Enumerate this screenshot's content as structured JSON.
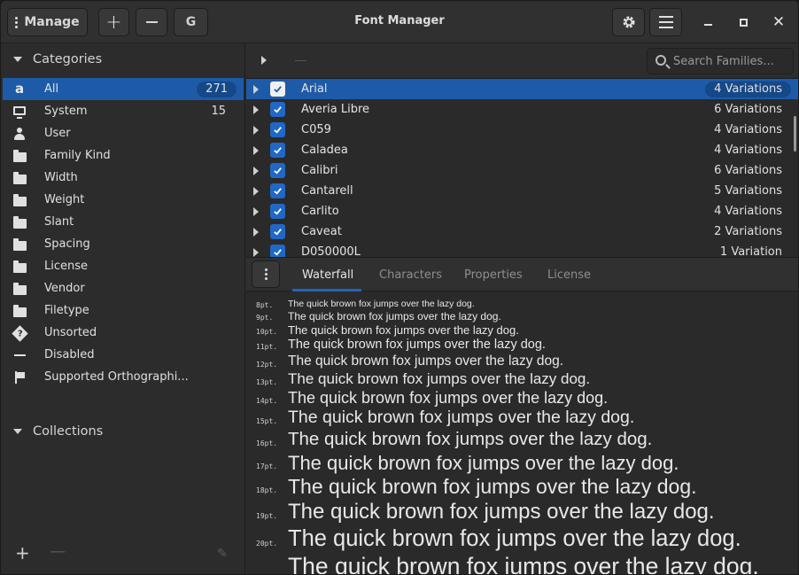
{
  "window": {
    "title": "Font Manager"
  },
  "header": {
    "manage_label": "Manage",
    "add_label": "+",
    "remove_label": "—",
    "g_label": "G",
    "min_label": "–",
    "max_label": "▫",
    "close_label": "✕"
  },
  "sidebar": {
    "categories_title": "Categories",
    "collections_title": "Collections",
    "items": [
      {
        "label": "All",
        "count": "271",
        "icon": "font-a-icon"
      },
      {
        "label": "System",
        "count": "15",
        "icon": "monitor-icon"
      },
      {
        "label": "User",
        "count": "",
        "icon": "person-icon"
      },
      {
        "label": "Family Kind",
        "count": "",
        "icon": "folder-icon"
      },
      {
        "label": "Width",
        "count": "",
        "icon": "folder-icon"
      },
      {
        "label": "Weight",
        "count": "",
        "icon": "folder-icon"
      },
      {
        "label": "Slant",
        "count": "",
        "icon": "folder-icon"
      },
      {
        "label": "Spacing",
        "count": "",
        "icon": "folder-icon"
      },
      {
        "label": "License",
        "count": "",
        "icon": "folder-icon"
      },
      {
        "label": "Vendor",
        "count": "",
        "icon": "folder-icon"
      },
      {
        "label": "Filetype",
        "count": "",
        "icon": "folder-icon"
      },
      {
        "label": "Unsorted",
        "count": "",
        "icon": "question-diamond-icon"
      },
      {
        "label": "Disabled",
        "count": "",
        "icon": "dash-icon"
      },
      {
        "label": "Supported Orthographi...",
        "count": "",
        "icon": "flag-icon"
      }
    ]
  },
  "search": {
    "placeholder": "Search Families..."
  },
  "fonts": [
    {
      "name": "Arial",
      "variations": "4 Variations"
    },
    {
      "name": "Averia Libre",
      "variations": "6 Variations"
    },
    {
      "name": "C059",
      "variations": "4 Variations"
    },
    {
      "name": "Caladea",
      "variations": "4 Variations"
    },
    {
      "name": "Calibri",
      "variations": "6 Variations"
    },
    {
      "name": "Cantarell",
      "variations": "5 Variations"
    },
    {
      "name": "Carlito",
      "variations": "4 Variations"
    },
    {
      "name": "Caveat",
      "variations": "2 Variations"
    },
    {
      "name": "D050000L",
      "variations": "1 Variation"
    }
  ],
  "tabs": [
    "Waterfall",
    "Characters",
    "Properties",
    "License"
  ],
  "preview": {
    "sample": "The quick brown fox jumps over the lazy dog.",
    "sizes": [
      "8pt.",
      "9pt.",
      "10pt.",
      "11pt.",
      "12pt.",
      "13pt.",
      "14pt.",
      "15pt.",
      "16pt.",
      "17pt.",
      "18pt.",
      "19pt.",
      "20pt.",
      ""
    ]
  },
  "colors": {
    "accent": "#1d5aa8",
    "badge": "#154888",
    "checkbox": "#2068c6"
  }
}
